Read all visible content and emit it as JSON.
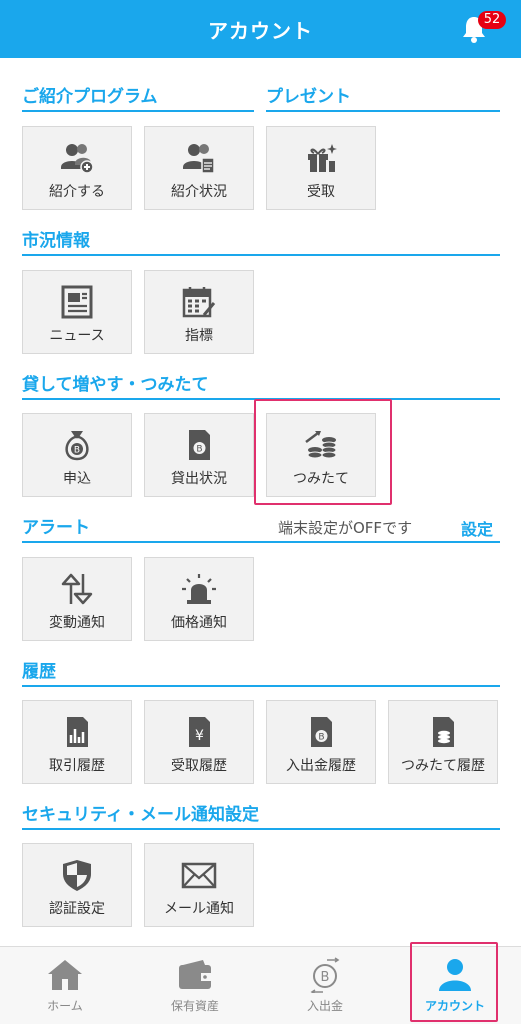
{
  "header": {
    "title": "アカウント",
    "notification_count": "52"
  },
  "sections": {
    "referral": {
      "title": "ご紹介プログラム",
      "items": [
        "紹介する",
        "紹介状況"
      ]
    },
    "present": {
      "title": "プレゼント",
      "items": [
        "受取"
      ]
    },
    "market": {
      "title": "市況情報",
      "items": [
        "ニュース",
        "指標"
      ]
    },
    "lending": {
      "title": "貸して増やす・つみたて",
      "items": [
        "申込",
        "貸出状況",
        "つみたて"
      ]
    },
    "alert": {
      "title": "アラート",
      "note": "端末設定がOFFです",
      "settings_label": "設定",
      "items": [
        "変動通知",
        "価格通知"
      ]
    },
    "history": {
      "title": "履歴",
      "items": [
        "取引履歴",
        "受取履歴",
        "入出金履歴",
        "つみたて履歴"
      ]
    },
    "security": {
      "title": "セキュリティ・メール通知設定",
      "items": [
        "認証設定",
        "メール通知"
      ]
    }
  },
  "tabbar": {
    "items": [
      {
        "label": "ホーム",
        "icon": "home-icon"
      },
      {
        "label": "保有資産",
        "icon": "wallet-icon"
      },
      {
        "label": "入出金",
        "icon": "deposit-withdraw-icon"
      },
      {
        "label": "アカウント",
        "icon": "account-icon",
        "active": true
      }
    ]
  },
  "colors": {
    "accent": "#1aa7ec",
    "badge": "#e60012",
    "highlight": "#e0306d",
    "icon": "#555555"
  }
}
